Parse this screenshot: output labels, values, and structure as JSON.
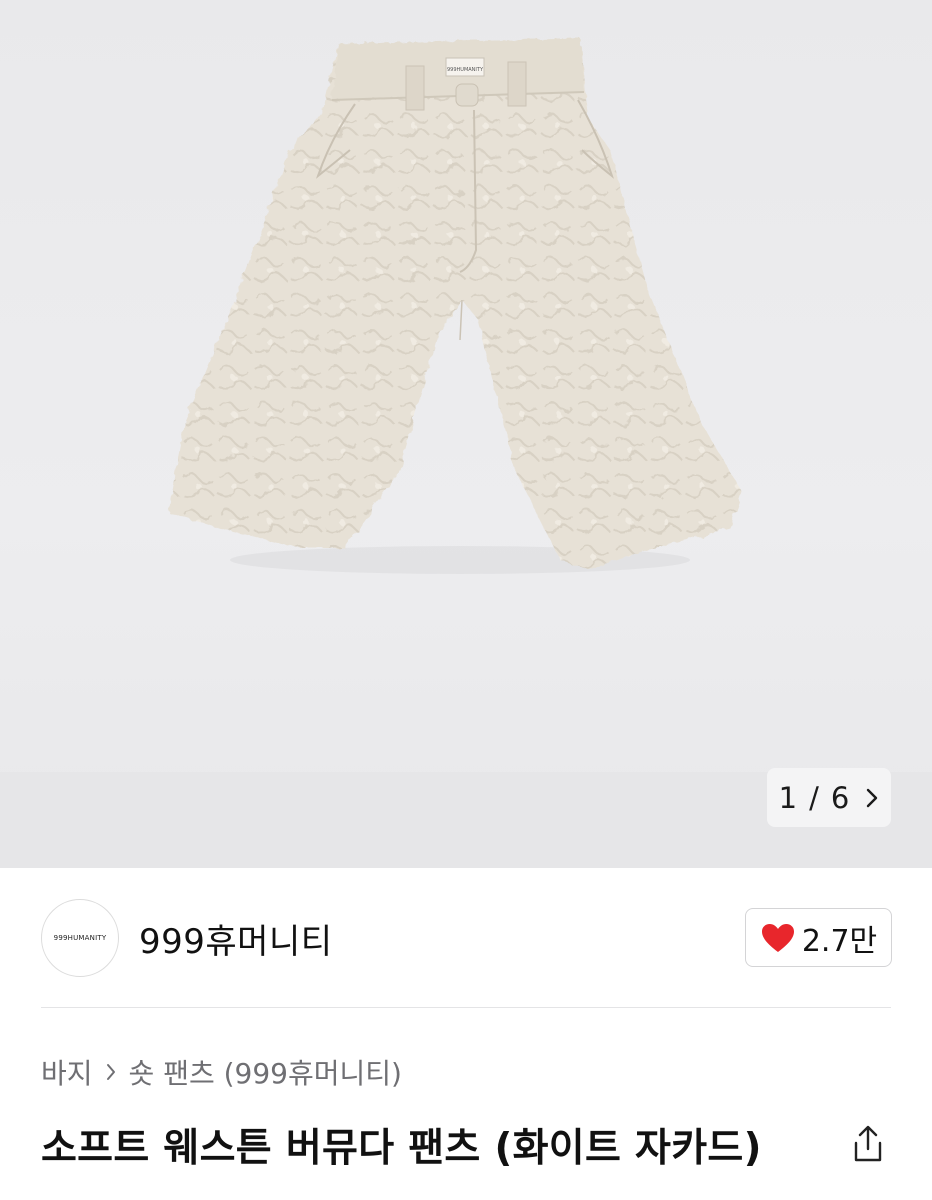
{
  "gallery": {
    "current": "1",
    "separator": "/",
    "total": "6",
    "tag_label": "999HUMANITY"
  },
  "brand": {
    "logo_text": "999HUMANITY",
    "name": "999휴머니티"
  },
  "likes": {
    "count": "2.7만",
    "heart_color": "#e8262c"
  },
  "breadcrumb": {
    "category": "바지",
    "subcategory": "숏 팬츠 (999휴머니티)"
  },
  "product": {
    "title": "소프트 웨스튼 버뮤다 팬츠 (화이트 자카드)"
  },
  "icons": {
    "next": "chevron-right-icon",
    "heart": "heart-icon",
    "share": "share-icon"
  }
}
